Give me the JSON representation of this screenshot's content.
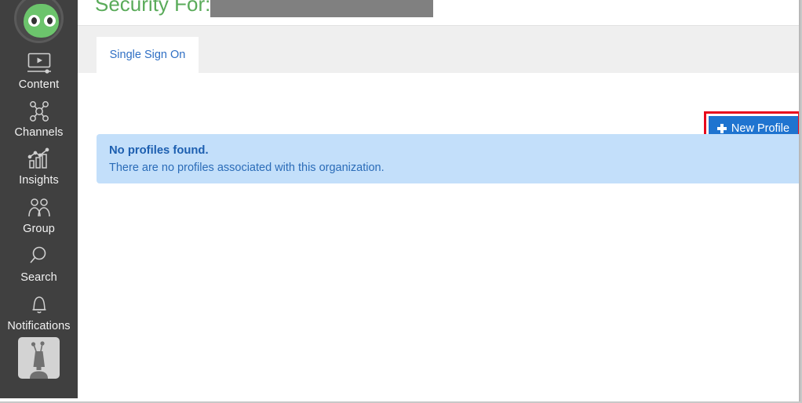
{
  "sidebar": {
    "logo_name": "mascot-logo",
    "items": [
      {
        "label": "Content",
        "icon": "video-monitor-icon"
      },
      {
        "label": "Channels",
        "icon": "network-nodes-icon"
      },
      {
        "label": "Insights",
        "icon": "bar-chart-trend-icon"
      },
      {
        "label": "Group",
        "icon": "people-group-icon"
      },
      {
        "label": "Search",
        "icon": "magnifier-icon"
      },
      {
        "label": "Notifications",
        "icon": "bell-icon"
      }
    ],
    "avatar": {
      "name": "user-avatar",
      "icon": "robot-avatar-icon"
    }
  },
  "header": {
    "title": "Security For:",
    "title_color": "#5aab5a",
    "redaction_name": "organization-name-redacted",
    "redaction_color": "#808080"
  },
  "tabs": [
    {
      "label": "Single Sign On",
      "active": true
    }
  ],
  "toolbar": {
    "new_profile_label": "New Profile",
    "new_profile_icon": "plus-icon",
    "button_color": "#1f74d0",
    "highlight_color": "#e8071c"
  },
  "alert": {
    "title": "No profiles found.",
    "message": "There are no profiles associated with this organization.",
    "background_color": "#c3dffa",
    "text_color": "#2b6cb8"
  }
}
